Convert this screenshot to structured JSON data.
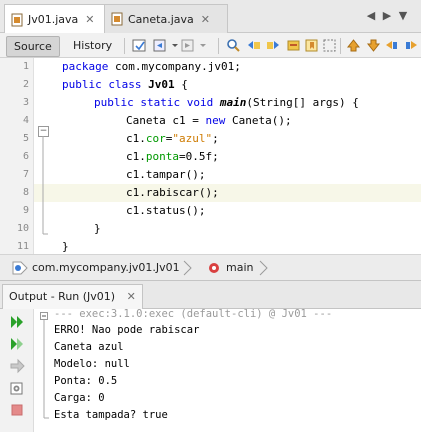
{
  "tabs": [
    {
      "label": "Jv01.java",
      "active": true
    },
    {
      "label": "Caneta.java",
      "active": false
    }
  ],
  "toolbar": {
    "source_label": "Source",
    "history_label": "History"
  },
  "line_numbers": [
    "1",
    "2",
    "3",
    "4",
    "5",
    "6",
    "7",
    "8",
    "9",
    "10",
    "11"
  ],
  "code": {
    "l1_kw": "package",
    "l1_rest": " com.mycompany.jv01;",
    "l2_kw": "public class",
    "l2_name": "Jv01",
    "l2_rest": " {",
    "l3_kw": "public static void",
    "l3_name": "main",
    "l3_rest": "(String[] args) {",
    "l4_a": "Caneta c1 = ",
    "l4_kw": "new",
    "l4_b": " Caneta();",
    "l5_a": "c1.",
    "l5_fld": "cor",
    "l5_b": "=",
    "l5_str": "\"azul\"",
    "l5_c": ";",
    "l6_a": "c1.",
    "l6_fld": "ponta",
    "l6_b": "=0.5f;",
    "l7": "c1.tampar();",
    "l8": "c1.rabiscar();",
    "l9": "c1.status();",
    "l10": "}",
    "l11": "}"
  },
  "breadcrumb": {
    "class_path": "com.mycompany.jv01.Jv01",
    "method": "main"
  },
  "output": {
    "tab_label": "Output - Run (Jv01)",
    "lines": [
      "--- exec:3.1.0:exec (default-cli) @ Jv01 ---",
      "ERRO! Nao pode rabiscar",
      "Caneta azul",
      "Modelo: null",
      "Ponta: 0.5",
      "Carga: 0",
      "Esta tampada? true"
    ]
  },
  "colors": {
    "keyword": "#0000e6",
    "field": "#009900",
    "string": "#ce7b00",
    "run": "#2aa12a"
  }
}
